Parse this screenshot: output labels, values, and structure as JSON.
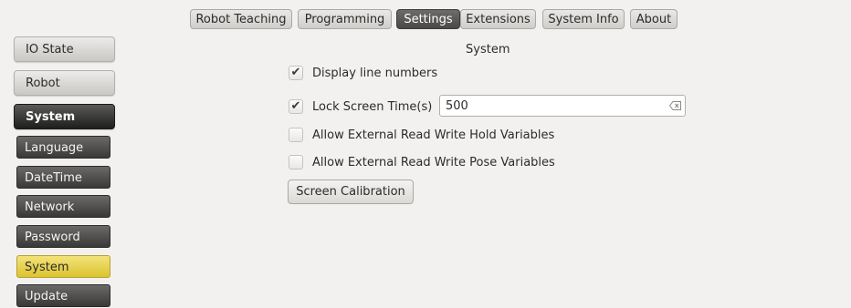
{
  "tabs": [
    {
      "label": "Robot Teaching",
      "active": false
    },
    {
      "label": "Programming",
      "active": false
    },
    {
      "label": "Settings",
      "active": true
    },
    {
      "label": "Extensions",
      "active": false
    },
    {
      "label": "System Info",
      "active": false
    },
    {
      "label": "About",
      "active": false
    }
  ],
  "sidebar": {
    "main": [
      {
        "label": "IO State",
        "active": false
      },
      {
        "label": "Robot",
        "active": false
      },
      {
        "label": "System",
        "active": true
      }
    ],
    "sub": [
      {
        "label": "Language",
        "active": false
      },
      {
        "label": "DateTime",
        "active": false
      },
      {
        "label": "Network",
        "active": false
      },
      {
        "label": "Password",
        "active": false
      },
      {
        "label": "System",
        "active": true
      },
      {
        "label": "Update",
        "active": false
      }
    ]
  },
  "content": {
    "title": "System",
    "options": [
      {
        "label": "Display line numbers",
        "checked": true
      },
      {
        "label": "Lock Screen Time(s)",
        "checked": true
      },
      {
        "label": "Allow External Read Write Hold Variables",
        "checked": false
      },
      {
        "label": "Allow External Read Write Pose Variables",
        "checked": false
      }
    ],
    "lock_time_value": "500",
    "calibration_button": "Screen Calibration",
    "check_glyph": "✔"
  },
  "colors": {
    "active_tab": "#4f4e4c",
    "active_sub": "#e3cc3c",
    "active_main": "#2a2a29"
  }
}
